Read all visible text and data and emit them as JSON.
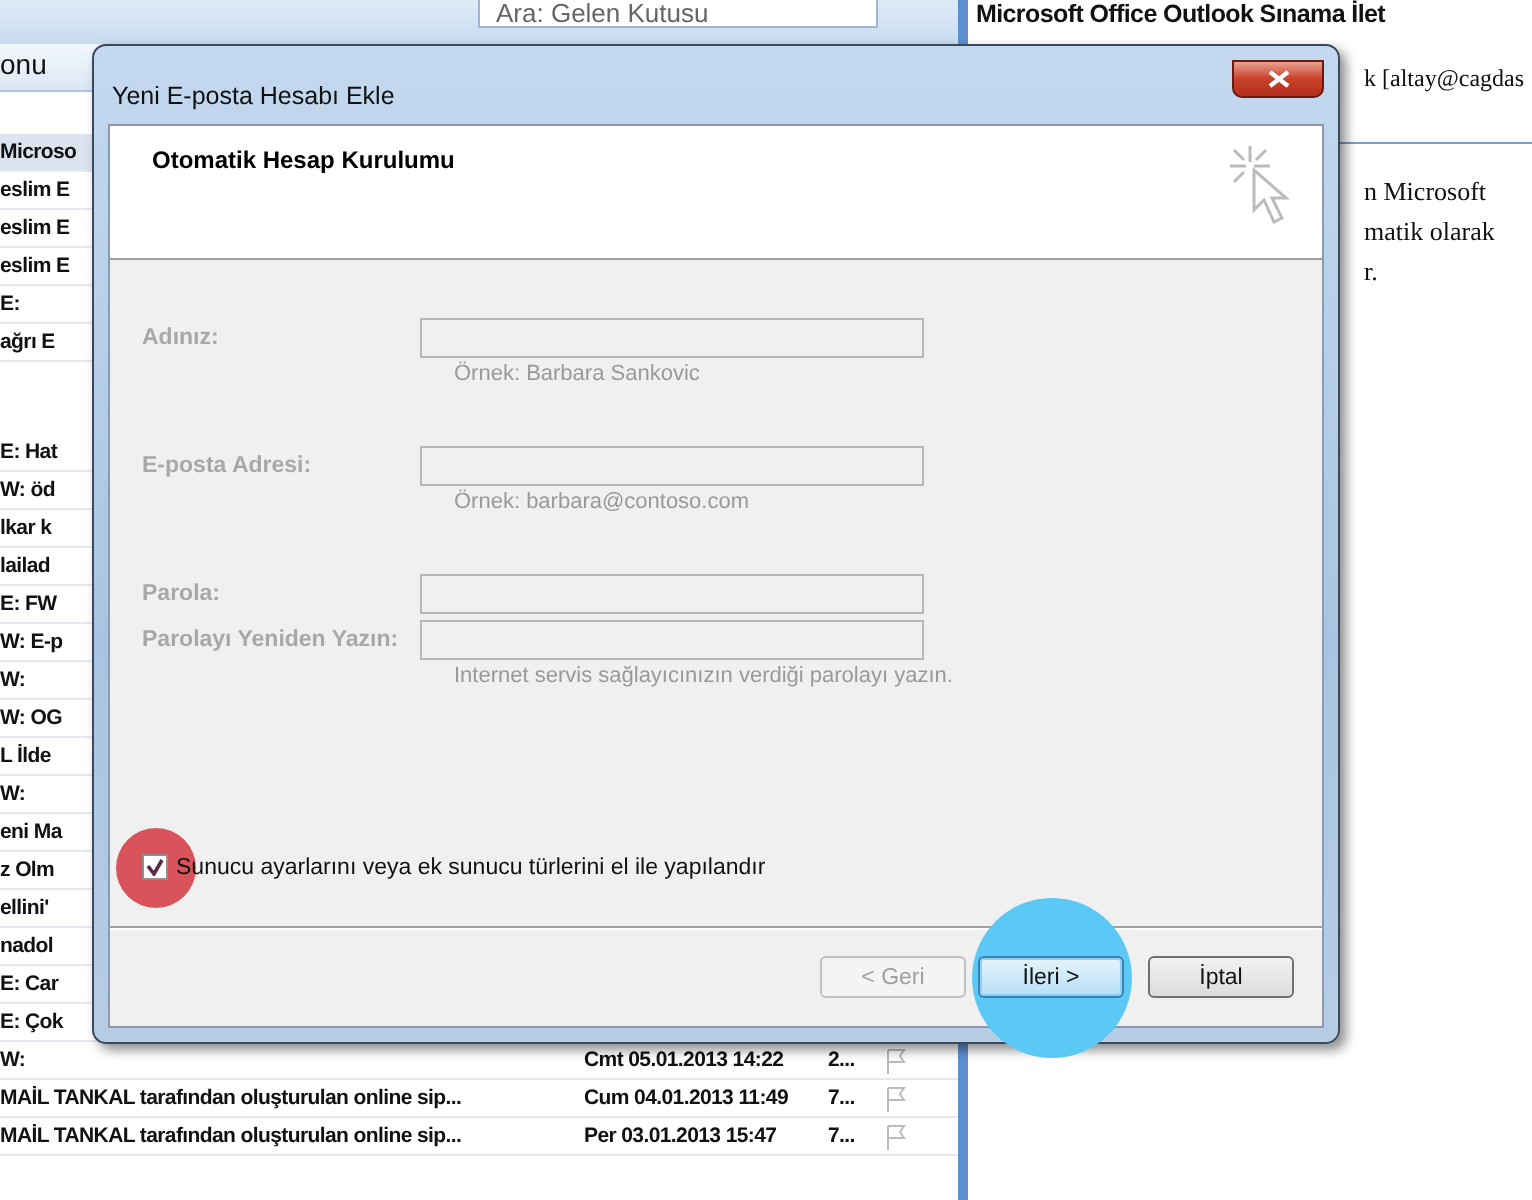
{
  "search": {
    "placeholder": "Ara: Gelen Kutusu"
  },
  "list_header": {
    "column_1": "onu"
  },
  "messages": [
    {
      "subject": "Microso",
      "selected": true
    },
    {
      "subject": "eslim E",
      "selected": false
    },
    {
      "subject": "eslim E",
      "selected": false
    },
    {
      "subject": "eslim E",
      "selected": false
    },
    {
      "subject": "E:",
      "selected": false
    },
    {
      "subject": "ağrı E",
      "selected": false
    },
    {
      "subject": "E: Hat",
      "selected": false
    },
    {
      "subject": "W: öd",
      "selected": false
    },
    {
      "subject": "lkar k",
      "selected": false
    },
    {
      "subject": "lailad",
      "selected": false
    },
    {
      "subject": "E: FW",
      "selected": false
    },
    {
      "subject": "W: E-p",
      "selected": false
    },
    {
      "subject": "W:",
      "selected": false
    },
    {
      "subject": "W: OG",
      "selected": false
    },
    {
      "subject": "L İlde",
      "selected": false
    },
    {
      "subject": "W:",
      "selected": false
    },
    {
      "subject": "eni Ma",
      "selected": false
    },
    {
      "subject": "z Olm",
      "selected": false
    },
    {
      "subject": "ellini'",
      "selected": false
    },
    {
      "subject": "nadol",
      "selected": false
    },
    {
      "subject": "E: Car",
      "selected": false
    },
    {
      "subject": "E: Çok",
      "selected": false
    },
    {
      "subject": "W:",
      "date": "Cmt 05.01.2013 14:22",
      "size": "2...",
      "selected": false
    },
    {
      "subject": "MAİL TANKAL tarafından oluşturulan online sip...",
      "date": "Cum 04.01.2013 11:49",
      "size": "7...",
      "selected": false
    },
    {
      "subject": "MAİL TANKAL tarafından oluşturulan online sip...",
      "date": "Per 03.01.2013 15:47",
      "size": "7...",
      "selected": false
    }
  ],
  "reading_pane": {
    "subject": "Microsoft Office Outlook Sınama İlet",
    "sender": "k [altay@cagdas",
    "body": [
      "n Microsoft",
      "matik olarak",
      "r."
    ]
  },
  "dialog": {
    "title": "Yeni E-posta Hesabı Ekle",
    "heading": "Otomatik Hesap Kurulumu",
    "fields": [
      {
        "label": "Adınız:",
        "hint": "Örnek: Barbara Sankovic",
        "disabled": true
      },
      {
        "label": "E-posta Adresi:",
        "hint": "Örnek: barbara@contoso.com",
        "disabled": true
      },
      {
        "label": "Parola:",
        "disabled": true
      },
      {
        "label": "Parolayı Yeniden Yazın:",
        "hint": "Internet servis sağlayıcınızın verdiği parolayı yazın.",
        "disabled": true
      }
    ],
    "manual_setup": {
      "label": "Sunucu ayarlarını veya ek sunucu türlerini el ile yapılandır",
      "checked": true,
      "color": "#d9535b"
    },
    "buttons": [
      {
        "label": "< Geri",
        "disabled": true,
        "default": false
      },
      {
        "label": "İleri >",
        "disabled": false,
        "default": true,
        "color": "#5bc8f5"
      },
      {
        "label": "İptal",
        "disabled": false,
        "default": false
      }
    ]
  }
}
